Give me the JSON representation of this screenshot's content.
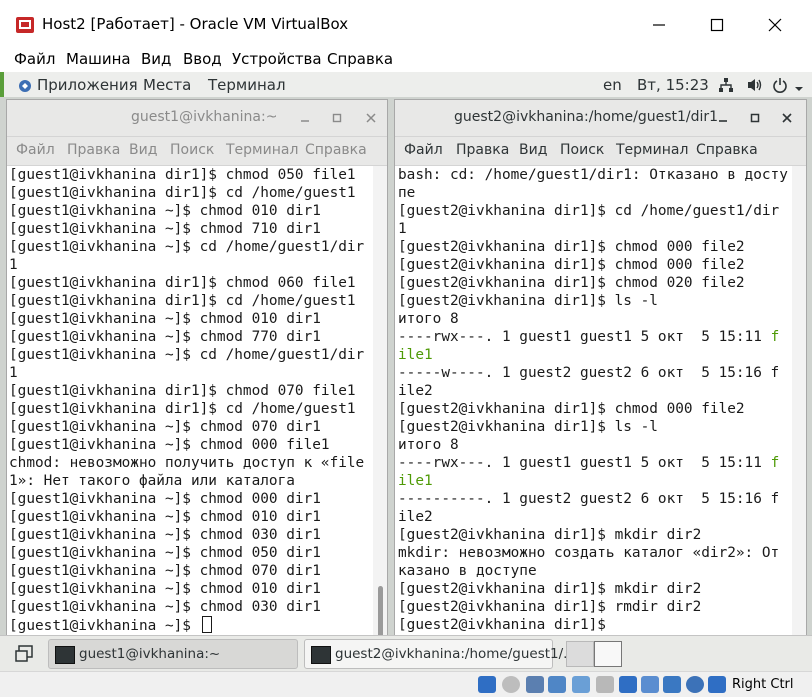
{
  "host": {
    "title": "Host2 [Работает] - Oracle VM VirtualBox",
    "menu": [
      "Файл",
      "Машина",
      "Вид",
      "Ввод",
      "Устройства",
      "Справка"
    ],
    "status_right": "Right Ctrl"
  },
  "guest_bar": {
    "applications": "Приложения",
    "places": "Места",
    "terminal": "Терминал",
    "lang": "en",
    "clock": "Вт, 15:23"
  },
  "terminal_menu": [
    "Файл",
    "Правка",
    "Вид",
    "Поиск",
    "Терминал",
    "Справка"
  ],
  "left_terminal": {
    "title": "guest1@ivkhanina:~",
    "lines": [
      "[guest1@ivkhanina dir1]$ chmod 050 file1",
      "[guest1@ivkhanina dir1]$ cd /home/guest1",
      "[guest1@ivkhanina ~]$ chmod 010 dir1",
      "[guest1@ivkhanina ~]$ chmod 710 dir1",
      "[guest1@ivkhanina ~]$ cd /home/guest1/dir",
      "1",
      "[guest1@ivkhanina dir1]$ chmod 060 file1",
      "[guest1@ivkhanina dir1]$ cd /home/guest1",
      "[guest1@ivkhanina ~]$ chmod 010 dir1",
      "[guest1@ivkhanina ~]$ chmod 770 dir1",
      "[guest1@ivkhanina ~]$ cd /home/guest1/dir",
      "1",
      "[guest1@ivkhanina dir1]$ chmod 070 file1",
      "[guest1@ivkhanina dir1]$ cd /home/guest1",
      "[guest1@ivkhanina ~]$ chmod 070 dir1",
      "[guest1@ivkhanina ~]$ chmod 000 file1",
      "chmod: невозможно получить доступ к «file",
      "1»: Нет такого файла или каталога",
      "[guest1@ivkhanina ~]$ chmod 000 dir1",
      "[guest1@ivkhanina ~]$ chmod 010 dir1",
      "[guest1@ivkhanina ~]$ chmod 030 dir1",
      "[guest1@ivkhanina ~]$ chmod 050 dir1",
      "[guest1@ivkhanina ~]$ chmod 070 dir1",
      "[guest1@ivkhanina ~]$ chmod 010 dir1",
      "[guest1@ivkhanina ~]$ chmod 030 dir1",
      "[guest1@ivkhanina ~]$ "
    ]
  },
  "right_terminal": {
    "title": "guest2@ivkhanina:/home/guest1/dir1",
    "lines": [
      {
        "t": "bash: cd: /home/guest1/dir1: Отказано в досту"
      },
      {
        "t": "пе"
      },
      {
        "t": "[guest2@ivkhanina dir1]$ cd /home/guest1/dir"
      },
      {
        "t": "1"
      },
      {
        "t": "[guest2@ivkhanina dir1]$ chmod 000 file2"
      },
      {
        "t": "[guest2@ivkhanina dir1]$ chmod 000 file2"
      },
      {
        "t": "[guest2@ivkhanina dir1]$ chmod 020 file2"
      },
      {
        "t": "[guest2@ivkhanina dir1]$ ls -l"
      },
      {
        "t": "итого 8"
      },
      {
        "t": "----rwx---. 1 guest1 guest1 5 окт  5 15:11 ",
        "g": "f"
      },
      {
        "t": "",
        "g": "ile1"
      },
      {
        "t": "-----w----. 1 guest2 guest2 6 окт  5 15:16 f"
      },
      {
        "t": "ile2"
      },
      {
        "t": "[guest2@ivkhanina dir1]$ chmod 000 file2"
      },
      {
        "t": "[guest2@ivkhanina dir1]$ ls -l"
      },
      {
        "t": "итого 8"
      },
      {
        "t": "----rwx---. 1 guest1 guest1 5 окт  5 15:11 ",
        "g": "f"
      },
      {
        "t": "",
        "g": "ile1"
      },
      {
        "t": "----------. 1 guest2 guest2 6 окт  5 15:16 f"
      },
      {
        "t": "ile2"
      },
      {
        "t": "[guest2@ivkhanina dir1]$ mkdir dir2"
      },
      {
        "t": "mkdir: невозможно создать каталог «dir2»: От"
      },
      {
        "t": "казано в доступе"
      },
      {
        "t": "[guest2@ivkhanina dir1]$ mkdir dir2"
      },
      {
        "t": "[guest2@ivkhanina dir1]$ rmdir dir2"
      },
      {
        "t": "[guest2@ivkhanina dir1]$ "
      }
    ]
  },
  "taskbar": {
    "task1": "guest1@ivkhanina:~",
    "task2": "guest2@ivkhanina:/home/guest1/..."
  },
  "colors": {
    "terminal_bg": "#ffffff",
    "terminal_fg": "#1a1a1a",
    "ls_executable": "#4e9a06",
    "guest_bar": "#edeeec",
    "titlebar_inactive_text": "#8a8a8a"
  }
}
